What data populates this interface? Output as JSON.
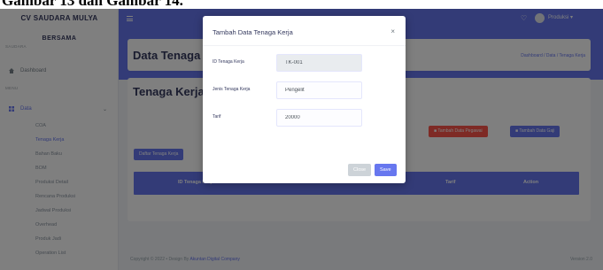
{
  "caption": "Gambar 13 dan Gambar 14.",
  "sidebar": {
    "brand": "CV SAUDARA MULYA",
    "brand_sub": "BERSAMA",
    "brand_sub2": "SAUDARA",
    "dashboard_label": "Dashboard",
    "menu_caption": "MENU",
    "data_label": "Data",
    "subitems": [
      "COA",
      "Tenaga Kerja",
      "Bahan Baku",
      "BOM",
      "Produksi Detail",
      "Rencana Produksi",
      "Jadwal Produksi",
      "Overhead",
      "Produk Jadi",
      "Operation List"
    ]
  },
  "topbar": {
    "user_label": "Produksi"
  },
  "page": {
    "header_title": "Data Tenaga Kerja",
    "breadcrumb": "Dashboard / Data / Tenaga Kerja",
    "section_title": "Tenaga Kerja",
    "btn_add_pegawai": "Tambah Data Pegawai",
    "btn_add_gaji": "Tambah Data Gaji",
    "btn_list": "Daftar Tenaga Kerja",
    "columns": [
      "ID Tenaga Kerja",
      "Tarif",
      "Action"
    ]
  },
  "footer": {
    "copyright": "Copyright © 2022 •  Design By",
    "company": "Akuntan Digital Company",
    "version": "Version 2.0"
  },
  "modal": {
    "title": "Tambah Data Tenaga Kerja",
    "close_icon": "×",
    "fields": [
      {
        "label": "ID Tenaga Kerja",
        "value": "TK-001"
      },
      {
        "label": "Jenis Tenaga Kerja",
        "value": "Pengelit"
      },
      {
        "label": "Tarif",
        "value": "20000"
      }
    ],
    "close_label": "Close",
    "save_label": "Save"
  },
  "colors": {
    "primary": "#6777ef",
    "danger": "#fc544b"
  }
}
